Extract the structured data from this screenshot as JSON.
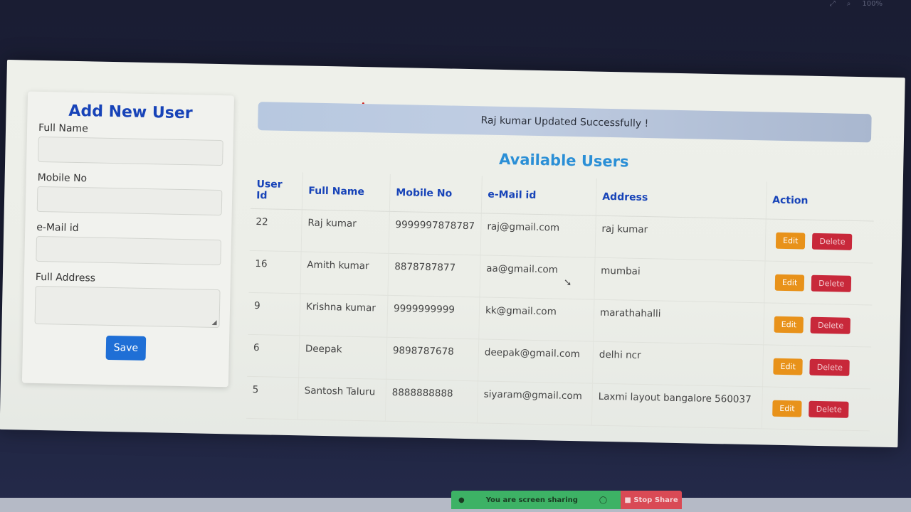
{
  "form": {
    "title": "Add New User",
    "fields": [
      {
        "label": "Full Name",
        "value": ""
      },
      {
        "label": "Mobile No",
        "value": ""
      },
      {
        "label": "e-Mail id",
        "value": ""
      },
      {
        "label": "Full Address",
        "value": ""
      }
    ],
    "save_label": "Save"
  },
  "alert": {
    "message": "Raj kumar Updated Successfully !"
  },
  "users": {
    "title": "Available Users",
    "columns": [
      "User Id",
      "Full Name",
      "Mobile No",
      "e-Mail id",
      "Address",
      "Action"
    ],
    "rows": [
      {
        "id": "22",
        "name": "Raj kumar",
        "mobile": "9999997878787",
        "email": "raj@gmail.com",
        "address": "raj kumar"
      },
      {
        "id": "16",
        "name": "Amith kumar",
        "mobile": "8878787877",
        "email": "aa@gmail.com",
        "address": "mumbai"
      },
      {
        "id": "9",
        "name": "Krishna kumar",
        "mobile": "9999999999",
        "email": "kk@gmail.com",
        "address": "marathahalli"
      },
      {
        "id": "6",
        "name": "Deepak",
        "mobile": "9898787678",
        "email": "deepak@gmail.com",
        "address": "delhi ncr"
      },
      {
        "id": "5",
        "name": "Santosh Taluru",
        "mobile": "8888888888",
        "email": "siyaram@gmail.com",
        "address": "Laxmi layout bangalore 560037"
      }
    ],
    "edit_label": "Edit",
    "delete_label": "Delete"
  },
  "sharing": {
    "status": "You are screen sharing",
    "stop_label": "Stop Share"
  },
  "zoom": "100%",
  "colors": {
    "accent": "#1743b8",
    "save": "#1f6fd6",
    "edit": "#e8921a",
    "delete": "#c8283a",
    "share": "#3db265",
    "stop": "#d94a55"
  }
}
